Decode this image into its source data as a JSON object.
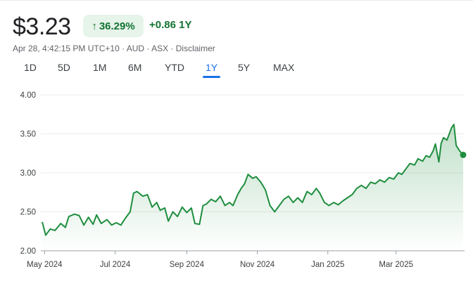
{
  "header": {
    "price": "$3.23",
    "change_percent": "36.29%",
    "change_value": "+0.86 1Y",
    "arrow_icon": "arrow-up-icon",
    "meta": "Apr 28, 4:42:15 PM UTC+10 · AUD · ASX · Disclaimer"
  },
  "tabs": {
    "selected": "1Y",
    "items": [
      {
        "label": "1D"
      },
      {
        "label": "5D"
      },
      {
        "label": "1M"
      },
      {
        "label": "6M"
      },
      {
        "label": "YTD"
      },
      {
        "label": "1Y"
      },
      {
        "label": "5Y"
      },
      {
        "label": "MAX"
      }
    ]
  },
  "colors": {
    "accent_green": "#1e8e3e",
    "pill_bg": "#e6f4ea",
    "tab_active": "#1a73e8"
  },
  "chart_data": {
    "type": "area",
    "title": "",
    "xlabel": "",
    "ylabel": "",
    "ylim": [
      2.0,
      4.0
    ],
    "yticks": [
      "4.00",
      "3.50",
      "3.00",
      "2.50",
      "2.00"
    ],
    "xticks": [
      "May 2024",
      "Jul 2024",
      "Sep 2024",
      "Nov 2024",
      "Jan 2025",
      "Mar 2025"
    ],
    "xtick_dates": [
      "2024-05-01",
      "2024-07-01",
      "2024-09-01",
      "2024-11-01",
      "2025-01-01",
      "2025-03-01"
    ],
    "grid": true,
    "series": [
      {
        "points": [
          [
            "2024-04-29",
            2.37
          ],
          [
            "2024-05-02",
            2.2
          ],
          [
            "2024-05-06",
            2.28
          ],
          [
            "2024-05-10",
            2.26
          ],
          [
            "2024-05-15",
            2.35
          ],
          [
            "2024-05-19",
            2.3
          ],
          [
            "2024-05-22",
            2.44
          ],
          [
            "2024-05-27",
            2.47
          ],
          [
            "2024-05-31",
            2.45
          ],
          [
            "2024-06-04",
            2.33
          ],
          [
            "2024-06-08",
            2.43
          ],
          [
            "2024-06-12",
            2.34
          ],
          [
            "2024-06-15",
            2.46
          ],
          [
            "2024-06-19",
            2.35
          ],
          [
            "2024-06-24",
            2.4
          ],
          [
            "2024-06-28",
            2.33
          ],
          [
            "2024-07-02",
            2.36
          ],
          [
            "2024-07-06",
            2.33
          ],
          [
            "2024-07-10",
            2.42
          ],
          [
            "2024-07-14",
            2.5
          ],
          [
            "2024-07-17",
            2.74
          ],
          [
            "2024-07-20",
            2.76
          ],
          [
            "2024-07-25",
            2.7
          ],
          [
            "2024-07-29",
            2.72
          ],
          [
            "2024-08-02",
            2.56
          ],
          [
            "2024-08-06",
            2.62
          ],
          [
            "2024-08-09",
            2.52
          ],
          [
            "2024-08-13",
            2.55
          ],
          [
            "2024-08-16",
            2.38
          ],
          [
            "2024-08-20",
            2.5
          ],
          [
            "2024-08-24",
            2.44
          ],
          [
            "2024-08-28",
            2.56
          ],
          [
            "2024-09-01",
            2.49
          ],
          [
            "2024-09-05",
            2.55
          ],
          [
            "2024-09-08",
            2.35
          ],
          [
            "2024-09-12",
            2.34
          ],
          [
            "2024-09-15",
            2.58
          ],
          [
            "2024-09-18",
            2.6
          ],
          [
            "2024-09-22",
            2.66
          ],
          [
            "2024-09-26",
            2.63
          ],
          [
            "2024-09-30",
            2.7
          ],
          [
            "2024-10-04",
            2.58
          ],
          [
            "2024-10-08",
            2.62
          ],
          [
            "2024-10-11",
            2.58
          ],
          [
            "2024-10-15",
            2.72
          ],
          [
            "2024-10-18",
            2.8
          ],
          [
            "2024-10-21",
            2.86
          ],
          [
            "2024-10-24",
            2.98
          ],
          [
            "2024-10-28",
            2.93
          ],
          [
            "2024-10-31",
            2.95
          ],
          [
            "2024-11-04",
            2.88
          ],
          [
            "2024-11-08",
            2.78
          ],
          [
            "2024-11-12",
            2.58
          ],
          [
            "2024-11-16",
            2.5
          ],
          [
            "2024-11-20",
            2.58
          ],
          [
            "2024-11-24",
            2.66
          ],
          [
            "2024-11-28",
            2.7
          ],
          [
            "2024-12-02",
            2.62
          ],
          [
            "2024-12-06",
            2.68
          ],
          [
            "2024-12-10",
            2.62
          ],
          [
            "2024-12-14",
            2.76
          ],
          [
            "2024-12-18",
            2.72
          ],
          [
            "2024-12-22",
            2.8
          ],
          [
            "2024-12-25",
            2.74
          ],
          [
            "2024-12-29",
            2.62
          ],
          [
            "2025-01-02",
            2.58
          ],
          [
            "2025-01-06",
            2.62
          ],
          [
            "2025-01-10",
            2.59
          ],
          [
            "2025-01-14",
            2.64
          ],
          [
            "2025-01-18",
            2.68
          ],
          [
            "2025-01-22",
            2.72
          ],
          [
            "2025-01-26",
            2.8
          ],
          [
            "2025-01-30",
            2.84
          ],
          [
            "2025-02-03",
            2.8
          ],
          [
            "2025-02-07",
            2.88
          ],
          [
            "2025-02-11",
            2.86
          ],
          [
            "2025-02-15",
            2.91
          ],
          [
            "2025-02-19",
            2.88
          ],
          [
            "2025-02-23",
            2.94
          ],
          [
            "2025-02-27",
            2.92
          ],
          [
            "2025-03-03",
            3.0
          ],
          [
            "2025-03-06",
            2.98
          ],
          [
            "2025-03-10",
            3.06
          ],
          [
            "2025-03-13",
            3.12
          ],
          [
            "2025-03-17",
            3.1
          ],
          [
            "2025-03-20",
            3.18
          ],
          [
            "2025-03-24",
            3.15
          ],
          [
            "2025-03-27",
            3.22
          ],
          [
            "2025-03-30",
            3.2
          ],
          [
            "2025-04-02",
            3.28
          ],
          [
            "2025-04-04",
            3.37
          ],
          [
            "2025-04-07",
            3.14
          ],
          [
            "2025-04-09",
            3.38
          ],
          [
            "2025-04-11",
            3.45
          ],
          [
            "2025-04-14",
            3.42
          ],
          [
            "2025-04-16",
            3.5
          ],
          [
            "2025-04-18",
            3.58
          ],
          [
            "2025-04-20",
            3.62
          ],
          [
            "2025-04-22",
            3.35
          ],
          [
            "2025-04-25",
            3.28
          ],
          [
            "2025-04-28",
            3.23
          ]
        ]
      }
    ]
  }
}
